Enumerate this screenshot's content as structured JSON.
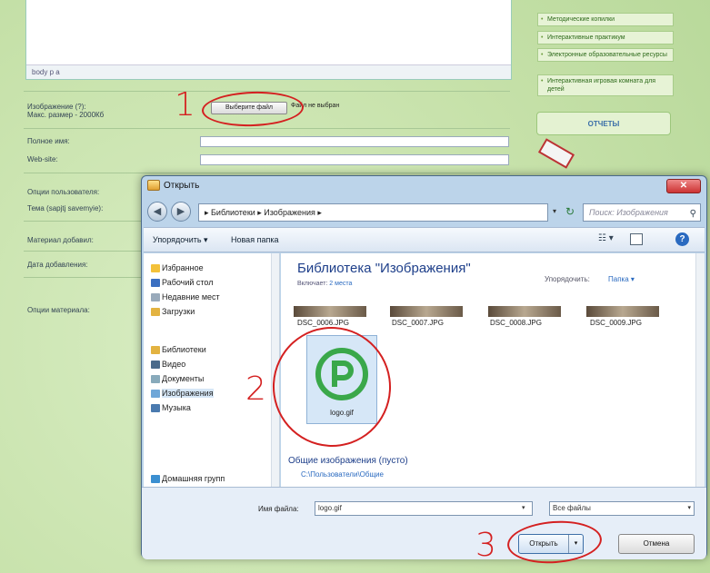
{
  "webpage": {
    "editor_path": "body  p  a",
    "labels": {
      "image": "Изображение (?):",
      "max_size": "Макс. размер - 2000Кб",
      "full_name": "Полное имя:",
      "website": "Web-site:",
      "user_info": "Опции пользователя:",
      "text_author": "Тема (sapjtj savemyie):",
      "material_added": "Материал добавил:",
      "date_added": "Дата добавления:",
      "material_options": "Опции материала:"
    },
    "file_button": "Выберите файл",
    "file_status": "Файл не выбран"
  },
  "sidebar": {
    "items": [
      "Методические копилки",
      "Интерактивные практикум",
      "Электронные образовательные ресурсы",
      "Интерактивная игровая комната для детей"
    ],
    "reports": "ОТЧЕТЫ"
  },
  "dialog": {
    "title": "Открыть",
    "close_glyph": "✕",
    "nav": {
      "back_glyph": "◀",
      "forward_glyph": "▶",
      "address": "▸ Библиотеки ▸ Изображения ▸",
      "address_dropdown": "▾",
      "refresh_glyph": "↻",
      "search_placeholder": "Поиск: Изображения",
      "search_glyph": "⚲"
    },
    "toolbar": {
      "organize": "Упорядочить ▾",
      "new_folder": "Новая папка",
      "view_glyph": "☷ ▾",
      "help_glyph": "?"
    },
    "nav_pane": {
      "favorites": "Избранное",
      "desktop": "Рабочий стол",
      "recent": "Недавние мест",
      "downloads": "Загрузки",
      "libraries": "Библиотеки",
      "video": "Видео",
      "documents": "Документы",
      "images": "Изображения",
      "music": "Музыка",
      "home_group": "Домашняя групп"
    },
    "content": {
      "title": "Библиотека \"Изображения\"",
      "includes": "Включает:",
      "includes_link": "2 места",
      "sort_label": "Упорядочить:",
      "sort_value": "Папка ▾",
      "files": [
        "DSC_0006.JPG",
        "DSC_0007.JPG",
        "DSC_0008.JPG",
        "DSC_0009.JPG"
      ],
      "selected_file": "logo.gif",
      "public_header": "Общие изображения (пусто)",
      "public_path": "C:\\Пользователи\\Общие"
    },
    "bottom": {
      "filename_label": "Имя файла:",
      "filename_value": "logo.gif",
      "filter": "Все файлы",
      "open": "Открыть",
      "cancel": "Отмена",
      "dropdown_glyph": "▾"
    }
  },
  "annotations": [
    "1",
    "2",
    "3"
  ],
  "colors": {
    "annotation_red": "#d42020",
    "logo_green": "#3aa84a",
    "page_green": "#c6e1a9"
  }
}
